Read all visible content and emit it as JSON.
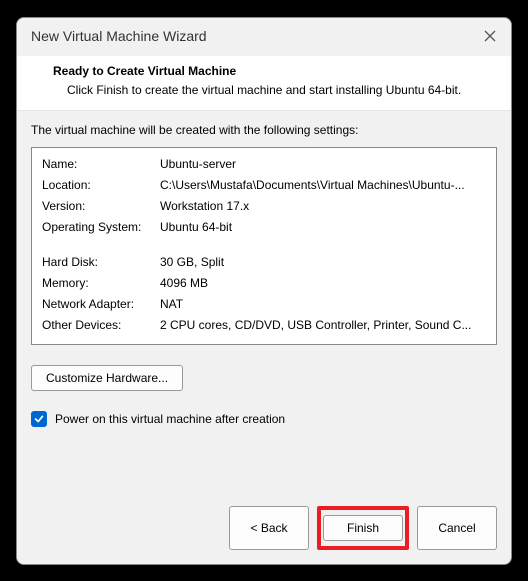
{
  "window": {
    "title": "New Virtual Machine Wizard"
  },
  "header": {
    "title": "Ready to Create Virtual Machine",
    "subtitle": "Click Finish to create the virtual machine and start installing Ubuntu 64-bit."
  },
  "intro": "The virtual machine will be created with the following settings:",
  "settings": {
    "name_label": "Name:",
    "name_value": "Ubuntu-server",
    "location_label": "Location:",
    "location_value": "C:\\Users\\Mustafa\\Documents\\Virtual Machines\\Ubuntu-...",
    "version_label": "Version:",
    "version_value": "Workstation 17.x",
    "os_label": "Operating System:",
    "os_value": "Ubuntu 64-bit",
    "disk_label": "Hard Disk:",
    "disk_value": "30 GB, Split",
    "memory_label": "Memory:",
    "memory_value": "4096 MB",
    "network_label": "Network Adapter:",
    "network_value": "NAT",
    "other_label": "Other Devices:",
    "other_value": "2 CPU cores, CD/DVD, USB Controller, Printer, Sound C..."
  },
  "customize_label": "Customize Hardware...",
  "checkbox_label": "Power on this virtual machine after creation",
  "buttons": {
    "back": "< Back",
    "finish": "Finish",
    "cancel": "Cancel"
  }
}
